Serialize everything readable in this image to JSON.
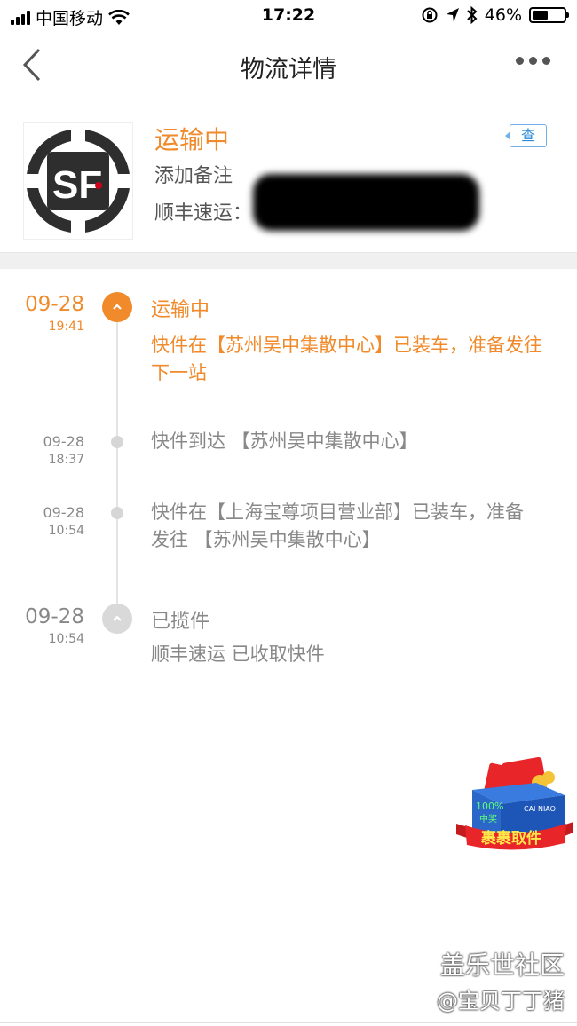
{
  "status_bar": {
    "carrier": "中国移动",
    "time": "17:22",
    "battery": "46%",
    "battery_level": 0.46
  },
  "nav": {
    "title": "物流详情"
  },
  "package": {
    "status": "运输中",
    "note_label": "添加备注",
    "carrier_label": "顺丰速运：",
    "query_label": "查",
    "logo_text": "SF"
  },
  "timeline": [
    {
      "date": "09-28",
      "time": "19:41",
      "title": "运输中",
      "desc": "快件在【苏州吴中集散中心】已装车，准备发往下一站",
      "active": true
    },
    {
      "date": "09-28",
      "time": "18:37",
      "desc": "快件到达 【苏州吴中集散中心】"
    },
    {
      "date": "09-28",
      "time": "10:54",
      "desc": "快件在【上海宝尊项目营业部】已装车，准备发往 【苏州吴中集散中心】"
    },
    {
      "date": "09-28",
      "time": "10:54",
      "title": "已揽件",
      "desc": "顺丰速运 已收取快件"
    }
  ],
  "promo": {
    "label": "裹裹取件",
    "percent": "100%",
    "tag": "中奖",
    "brand": "CAI NIAO"
  },
  "watermark": {
    "line1": "盖乐世社区",
    "line2": "@宝贝丁丁猪"
  }
}
